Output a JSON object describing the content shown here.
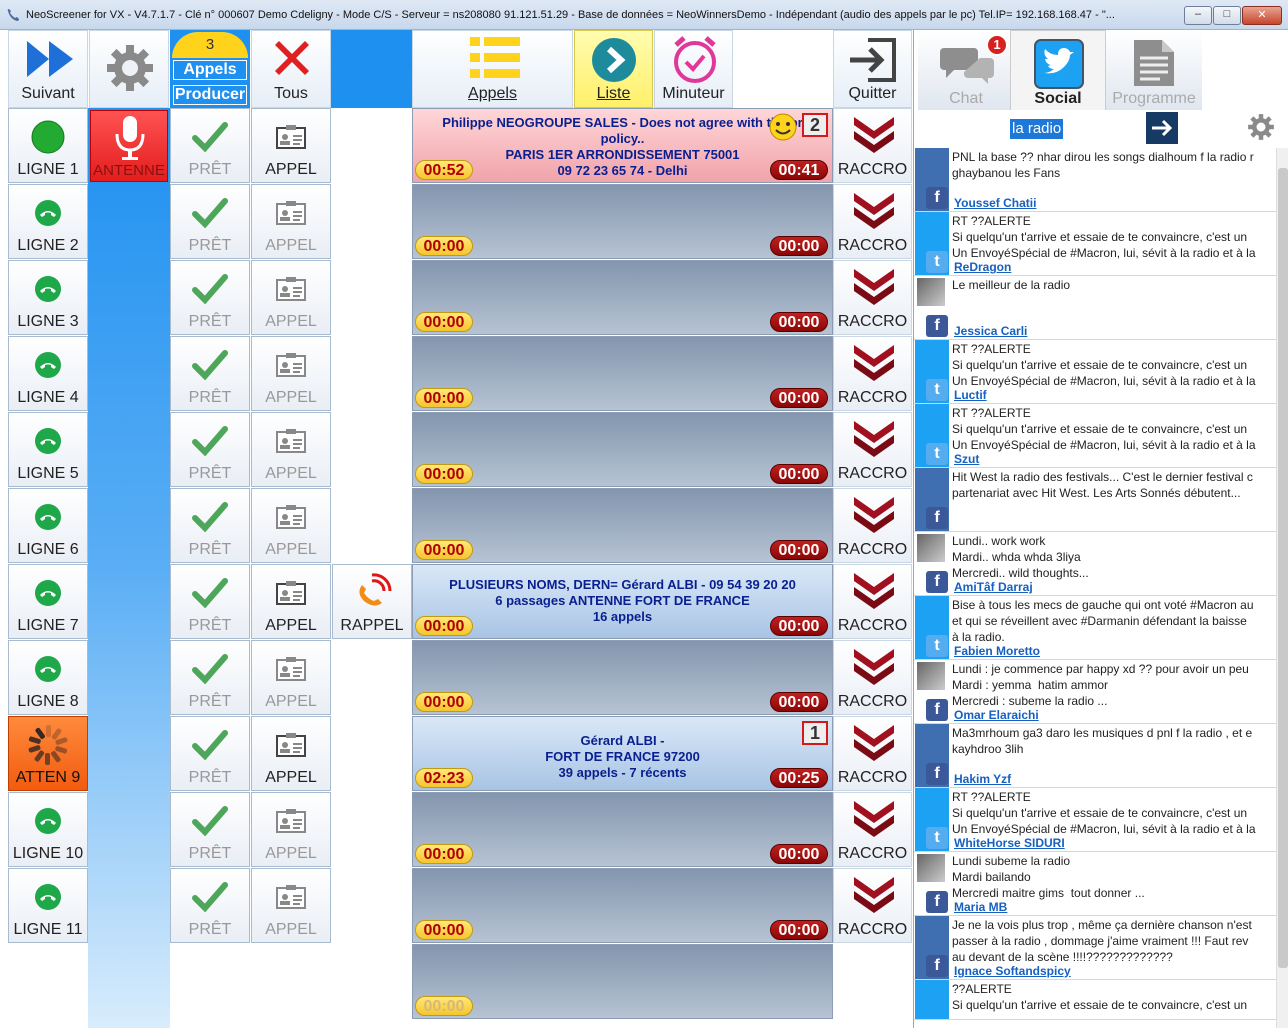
{
  "window": {
    "title": "NeoScreener for VX - V4.7.1.7 -  Clé n° 000607 Demo Cdeligny - Mode C/S -  Serveur = ns208080 91.121.51.29 - Base de données = NeoWinnersDemo - Indépendant (audio des appels par le pc) Tel.IP= 192.168.168.47 - \"...",
    "min": "–",
    "max": "□",
    "close": "✕"
  },
  "toolbar": {
    "suivant": "Suivant",
    "tous": "Tous",
    "appels_count": "3",
    "appels": "Appels",
    "producer": "Producer",
    "appels_tab": "Appels",
    "liste": "Liste",
    "minuteur": "Minuteur",
    "quitter": "Quitter"
  },
  "antenne": "ANTENNE",
  "lines": [
    {
      "label": "LIGNE  1",
      "pret": "PRÊT",
      "appel": "APPEL",
      "raccro": "RACCRO",
      "t1": "00:52",
      "t2": "00:41",
      "text": "Philippe NEOGROUPE SALES - Does not agree with the pr\npolicy..\nPARIS 1ER ARRONDISSEMENT 75001\n09 72 23 65 74 - Delhi",
      "badge": "2"
    },
    {
      "label": "LIGNE  2",
      "pret": "PRÊT",
      "appel": "APPEL",
      "raccro": "RACCRO",
      "t1": "00:00",
      "t2": "00:00"
    },
    {
      "label": "LIGNE  3",
      "pret": "PRÊT",
      "appel": "APPEL",
      "raccro": "RACCRO",
      "t1": "00:00",
      "t2": "00:00"
    },
    {
      "label": "LIGNE  4",
      "pret": "PRÊT",
      "appel": "APPEL",
      "raccro": "RACCRO",
      "t1": "00:00",
      "t2": "00:00"
    },
    {
      "label": "LIGNE  5",
      "pret": "PRÊT",
      "appel": "APPEL",
      "raccro": "RACCRO",
      "t1": "00:00",
      "t2": "00:00"
    },
    {
      "label": "LIGNE  6",
      "pret": "PRÊT",
      "appel": "APPEL",
      "raccro": "RACCRO",
      "t1": "00:00",
      "t2": "00:00"
    },
    {
      "label": "LIGNE  7",
      "pret": "PRÊT",
      "appel": "APPEL",
      "raccro": "RACCRO",
      "t1": "00:00",
      "t2": "00:00",
      "rappel": "RAPPEL",
      "text": "PLUSIEURS NOMS, DERN= Gérard ALBI - 09 54 39 20 20\n6 passages ANTENNE FORT DE FRANCE\n16 appels"
    },
    {
      "label": "LIGNE  8",
      "pret": "PRÊT",
      "appel": "APPEL",
      "raccro": "RACCRO",
      "t1": "00:00",
      "t2": "00:00"
    },
    {
      "label": "ATTEN 9",
      "pret": "PRÊT",
      "appel": "APPEL",
      "raccro": "RACCRO",
      "t1": "02:23",
      "t2": "00:25",
      "text": "Gérard ALBI -\nFORT DE FRANCE 97200\n39 appels - 7 récents",
      "badge": "1"
    },
    {
      "label": "LIGNE  10",
      "pret": "PRÊT",
      "appel": "APPEL",
      "raccro": "RACCRO",
      "t1": "00:00",
      "t2": "00:00"
    },
    {
      "label": "LIGNE  11",
      "pret": "PRÊT",
      "appel": "APPEL",
      "raccro": "RACCRO",
      "t1": "00:00",
      "t2": "00:00"
    },
    {
      "t1": "00:00"
    }
  ],
  "right": {
    "chat": "Chat",
    "chat_badge": "1",
    "social": "Social",
    "programme": "Programme",
    "search": "la radio"
  },
  "feed": [
    {
      "type": "fb",
      "side": "fb",
      "text": "PNL la base ?? nhar dirou les songs dialhoum f la radio r\nghaybanou les Fans",
      "name": "Youssef Chatii"
    },
    {
      "type": "tw",
      "side": "tw",
      "text": "RT ??ALERTE\nSi quelqu'un t'arrive et essaie de te convaincre, c'est un\nUn EnvoyéSpécial de #Macron, lui, sévit à la radio et à la",
      "name": "ReDragon"
    },
    {
      "type": "fb",
      "side": "photo",
      "text": "Le meilleur de la radio",
      "name": "Jessica Carli"
    },
    {
      "type": "tw",
      "side": "tw",
      "text": "RT ??ALERTE\nSi quelqu'un t'arrive et essaie de te convaincre, c'est un\nUn EnvoyéSpécial de #Macron, lui, sévit à la radio et à la",
      "name": "Luctif"
    },
    {
      "type": "tw",
      "side": "tw",
      "text": "RT ??ALERTE\nSi quelqu'un t'arrive et essaie de te convaincre, c'est un\nUn EnvoyéSpécial de #Macron, lui, sévit à la radio et à la",
      "name": "Szut"
    },
    {
      "type": "fb",
      "side": "fb",
      "text": "Hit West la radio des festivals... C'est le dernier festival c\npartenariat avec Hit West. Les Arts Sonnés débutent...",
      "name": ""
    },
    {
      "type": "fb",
      "side": "photo",
      "text": "Lundi.. work work\nMardi.. whda whda 3liya\nMercredi.. wild thoughts...",
      "name": "AmiTâf Darraj"
    },
    {
      "type": "tw",
      "side": "tw",
      "text": "Bise à tous les mecs de gauche qui ont voté #Macron au\net qui se réveillent avec #Darmanin défendant la baisse\nà la radio.",
      "name": "Fabien Moretto"
    },
    {
      "type": "fb",
      "side": "photo",
      "text": "Lundi : je commence par happy xd ?? pour avoir un peu\nMardi : yemma  hatim ammor\nMercredi : subeme la radio ...",
      "name": "Omar Elaraichi"
    },
    {
      "type": "fb",
      "side": "fb",
      "text": "Ma3mrhoum ga3 daro les musiques d pnl f la radio , et e\nkayhdroo 3lih",
      "name": "Hakim Yzf"
    },
    {
      "type": "tw",
      "side": "tw",
      "text": "RT ??ALERTE\nSi quelqu'un t'arrive et essaie de te convaincre, c'est un\nUn EnvoyéSpécial de #Macron, lui, sévit à la radio et à la",
      "name": "WhiteHorse SIDURI"
    },
    {
      "type": "fb",
      "side": "photo",
      "text": "Lundi subeme la radio\nMardi bailando\nMercredi maitre gims  tout donner ...",
      "name": "Maria MB"
    },
    {
      "type": "fb",
      "side": "fb",
      "text": "Je ne la vois plus trop , même ça dernière chanson n'est\npasser à la radio , dommage j'aime vraiment !!! Faut rev\nau devant de la scène !!!!?????????????",
      "name": "Ignace Softandspicy"
    },
    {
      "type": "tw",
      "side": "tw",
      "text": "??ALERTE\nSi quelqu'un t'arrive et essaie de te convaincre, c'est un",
      "name": ""
    }
  ]
}
